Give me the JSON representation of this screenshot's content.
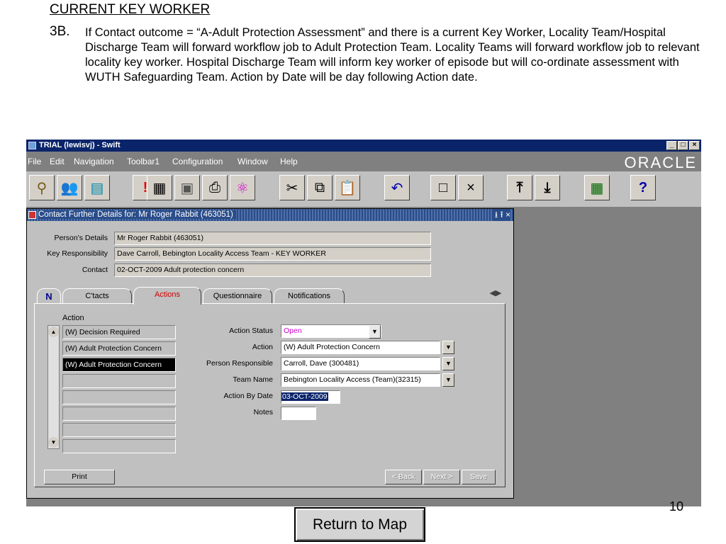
{
  "slide": {
    "heading": "CURRENT KEY WORKER",
    "number": "3B.",
    "paragraph": "If Contact outcome = “A-Adult Protection Assessment” and there is a current Key Worker, Locality Team/Hospital Discharge Team will forward workflow job to Adult Protection Team. Locality Teams will forward workflow job to relevant locality key worker.  Hospital Discharge Team will inform key worker of episode but will co-ordinate assessment with WUTH Safeguarding Team.  Action by Date will be day following Action date.",
    "page_number": "10",
    "return_button": "Return to Map"
  },
  "app": {
    "title": "TRIAL (lewisvj) - Swift",
    "window_controls": [
      "_",
      "□",
      "×"
    ],
    "menu": [
      "File",
      "Edit",
      "Navigation",
      "Toolbar1",
      "Configuration",
      "Window",
      "Help"
    ],
    "brand": "ORACLE",
    "toolbar": [
      {
        "name": "navigator-icon",
        "glyph": "⚲"
      },
      {
        "name": "people-icon",
        "glyph": "👥"
      },
      {
        "name": "id-card-icon",
        "glyph": "▤"
      },
      {
        "name": "alert-icon",
        "glyph": "!"
      },
      {
        "name": "calculator-icon",
        "glyph": "▦"
      },
      {
        "name": "save-icon",
        "glyph": "▣"
      },
      {
        "name": "print-icon",
        "glyph": "⎙"
      },
      {
        "name": "atom-icon",
        "glyph": "⚛"
      },
      {
        "name": "cut-icon",
        "glyph": "✂"
      },
      {
        "name": "copy-icon",
        "glyph": "⧉"
      },
      {
        "name": "paste-icon",
        "glyph": "📋"
      },
      {
        "name": "undo-icon",
        "glyph": "↶"
      },
      {
        "name": "new-document-icon",
        "glyph": "□"
      },
      {
        "name": "close-x-icon",
        "glyph": "×"
      },
      {
        "name": "upload-icon",
        "glyph": "⤒"
      },
      {
        "name": "download-icon",
        "glyph": "⤓"
      },
      {
        "name": "calendar-grid-icon",
        "glyph": "▦"
      },
      {
        "name": "help-icon",
        "glyph": "?"
      }
    ]
  },
  "form": {
    "title": "Contact Further Details for:  Mr Roger Rabbit (463051)",
    "title_controls": "⭳ ⭱ ×",
    "labels": {
      "persons_details": "Person's Details",
      "key_responsibility": "Key Responsibility",
      "contact": "Contact"
    },
    "values": {
      "persons_details": "Mr Roger Rabbit (463051)",
      "key_responsibility": "Dave Carroll, Bebington Locality Access Team - KEY WORKER",
      "contact": "02-OCT-2009 Adult protection concern"
    },
    "tabs": {
      "icon": "N",
      "items": [
        "C'tacts",
        "Actions",
        "Questionnaire",
        "Notifications"
      ]
    },
    "action_column_header": "Action",
    "action_list": [
      "(W) Decision Required",
      "(W) Adult Protection Concern",
      "(W) Adult Protection Concern",
      "",
      "",
      "",
      "",
      "",
      ""
    ],
    "detail_labels": {
      "action_status": "Action Status",
      "action": "Action",
      "person_responsible": "Person Responsible",
      "team_name": "Team Name",
      "action_by_date": "Action By Date",
      "notes": "Notes"
    },
    "detail_values": {
      "action_status": "Open",
      "action": "(W) Adult Protection Concern",
      "person_responsible": "Carroll, Dave (300481)",
      "team_name": "Bebington Locality Access (Team)(32315)",
      "action_by_date": "03-OCT-2009",
      "notes": ""
    },
    "buttons": {
      "print": "Print",
      "back": "< Back",
      "next": "Next >",
      "save": "Save"
    }
  },
  "colors": {
    "title_bar": "#0a246a",
    "app_bg": "#808080",
    "form_bg": "#c0c0c0",
    "active_tab_text": "#d00000",
    "status_text": "#cc00cc",
    "selection_bg": "#0a246a"
  }
}
